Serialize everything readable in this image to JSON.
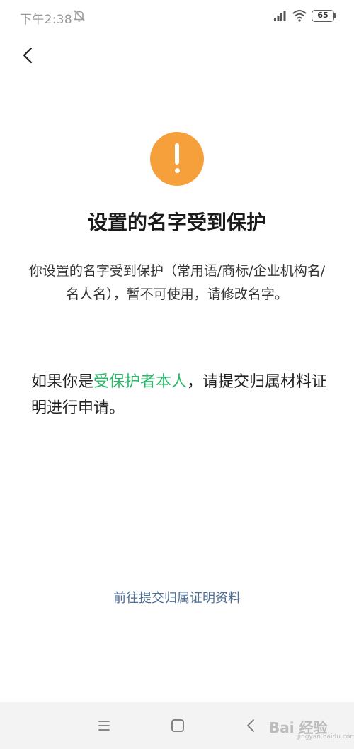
{
  "status_bar": {
    "time": "下午2:38",
    "battery": "65",
    "icons": [
      "bell-off-icon",
      "signal-icon",
      "wifi-icon",
      "battery-icon"
    ]
  },
  "header": {
    "back_icon": "chevron-left-icon"
  },
  "main": {
    "icon": "warning-exclamation-icon",
    "icon_color": "#f5a03a",
    "title": "设置的名字受到保护",
    "description": "你设置的名字受到保护（常用语/商标/企业机构名/名人名），暂不可使用，请修改名字。",
    "apply_prefix": "如果你是",
    "apply_highlight": "受保护者本人",
    "apply_suffix": "，请提交归属材料证明进行申请。",
    "highlight_color": "#2bb86a",
    "submit_link": "前往提交归属证明资料",
    "link_color": "#4e6e96"
  },
  "nav_bar": {
    "icons": [
      "menu-icon",
      "home-square-icon",
      "back-chevron-icon"
    ]
  },
  "watermark": {
    "text": "Bai 经验",
    "sub": "jingyan.baidu.com"
  }
}
